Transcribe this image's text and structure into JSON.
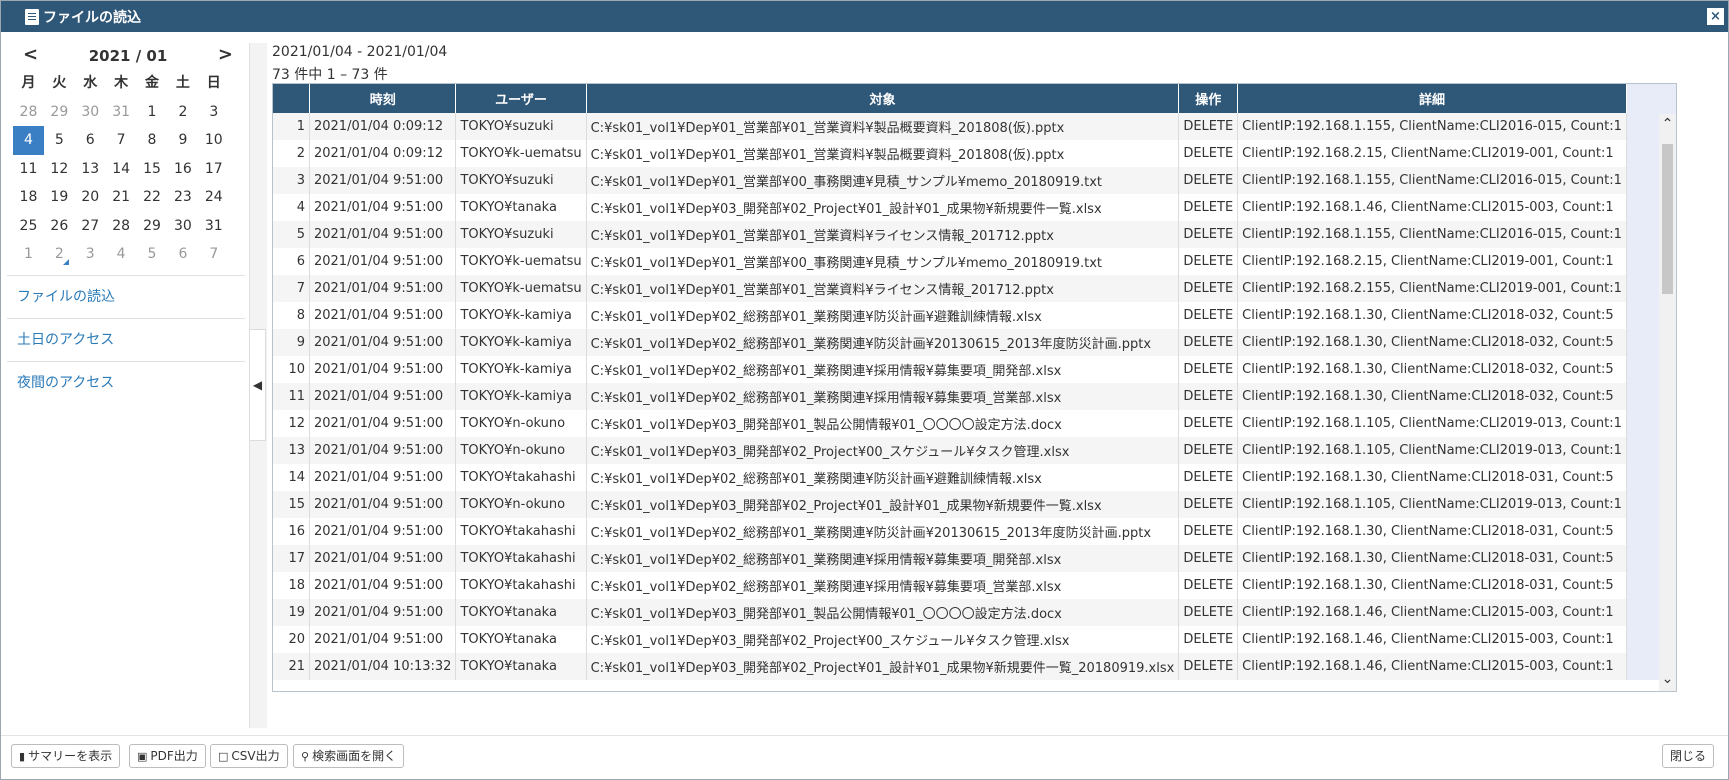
{
  "window": {
    "title": "ファイルの読込",
    "close_label": "×"
  },
  "calendar": {
    "month_label": "2021 / 01",
    "prev": "<",
    "next": ">",
    "weekdays": [
      "月",
      "火",
      "水",
      "木",
      "金",
      "土",
      "日"
    ],
    "days": [
      {
        "d": "28",
        "muted": true
      },
      {
        "d": "29",
        "muted": true
      },
      {
        "d": "30",
        "muted": true
      },
      {
        "d": "31",
        "muted": true
      },
      {
        "d": "1"
      },
      {
        "d": "2"
      },
      {
        "d": "3"
      },
      {
        "d": "4",
        "selected": true
      },
      {
        "d": "5"
      },
      {
        "d": "6"
      },
      {
        "d": "7"
      },
      {
        "d": "8"
      },
      {
        "d": "9"
      },
      {
        "d": "10"
      },
      {
        "d": "11"
      },
      {
        "d": "12"
      },
      {
        "d": "13"
      },
      {
        "d": "14"
      },
      {
        "d": "15"
      },
      {
        "d": "16"
      },
      {
        "d": "17"
      },
      {
        "d": "18"
      },
      {
        "d": "19"
      },
      {
        "d": "20"
      },
      {
        "d": "21"
      },
      {
        "d": "22"
      },
      {
        "d": "23"
      },
      {
        "d": "24"
      },
      {
        "d": "25"
      },
      {
        "d": "26"
      },
      {
        "d": "27"
      },
      {
        "d": "28"
      },
      {
        "d": "29"
      },
      {
        "d": "30"
      },
      {
        "d": "31"
      },
      {
        "d": "1",
        "muted": true
      },
      {
        "d": "2",
        "muted": true,
        "mark": true
      },
      {
        "d": "3",
        "muted": true
      },
      {
        "d": "4",
        "muted": true
      },
      {
        "d": "5",
        "muted": true
      },
      {
        "d": "6",
        "muted": true
      },
      {
        "d": "7",
        "muted": true
      }
    ]
  },
  "menu": [
    "ファイルの読込",
    "土日のアクセス",
    "夜間のアクセス"
  ],
  "collapse_label": "◀",
  "range_text": "2021/01/04 - 2021/01/04",
  "count_text": "73 件中 1 – 73 件",
  "table": {
    "headers": [
      "",
      "時刻",
      "ユーザー",
      "対象",
      "操作",
      "詳細"
    ],
    "rows": [
      [
        "1",
        "2021/01/04 0:09:12",
        "TOKYO¥suzuki",
        "C:¥sk01_vol1¥Dep¥01_営業部¥01_営業資料¥製品概要資料_201808(仮).pptx",
        "DELETE",
        "ClientIP:192.168.1.155, ClientName:CLI2016-015, Count:1"
      ],
      [
        "2",
        "2021/01/04 0:09:12",
        "TOKYO¥k-uematsu",
        "C:¥sk01_vol1¥Dep¥01_営業部¥01_営業資料¥製品概要資料_201808(仮).pptx",
        "DELETE",
        "ClientIP:192.168.2.15, ClientName:CLI2019-001, Count:1"
      ],
      [
        "3",
        "2021/01/04 9:51:00",
        "TOKYO¥suzuki",
        "C:¥sk01_vol1¥Dep¥01_営業部¥00_事務関連¥見積_サンプル¥memo_20180919.txt",
        "DELETE",
        "ClientIP:192.168.1.155, ClientName:CLI2016-015, Count:1"
      ],
      [
        "4",
        "2021/01/04 9:51:00",
        "TOKYO¥tanaka",
        "C:¥sk01_vol1¥Dep¥03_開発部¥02_Project¥01_設計¥01_成果物¥新規要件一覧.xlsx",
        "DELETE",
        "ClientIP:192.168.1.46, ClientName:CLI2015-003, Count:1"
      ],
      [
        "5",
        "2021/01/04 9:51:00",
        "TOKYO¥suzuki",
        "C:¥sk01_vol1¥Dep¥01_営業部¥01_営業資料¥ライセンス情報_201712.pptx",
        "DELETE",
        "ClientIP:192.168.1.155, ClientName:CLI2016-015, Count:1"
      ],
      [
        "6",
        "2021/01/04 9:51:00",
        "TOKYO¥k-uematsu",
        "C:¥sk01_vol1¥Dep¥01_営業部¥00_事務関連¥見積_サンプル¥memo_20180919.txt",
        "DELETE",
        "ClientIP:192.168.2.15, ClientName:CLI2019-001, Count:1"
      ],
      [
        "7",
        "2021/01/04 9:51:00",
        "TOKYO¥k-uematsu",
        "C:¥sk01_vol1¥Dep¥01_営業部¥01_営業資料¥ライセンス情報_201712.pptx",
        "DELETE",
        "ClientIP:192.168.2.155, ClientName:CLI2019-001, Count:1"
      ],
      [
        "8",
        "2021/01/04 9:51:00",
        "TOKYO¥k-kamiya",
        "C:¥sk01_vol1¥Dep¥02_総務部¥01_業務関連¥防災計画¥避難訓練情報.xlsx",
        "DELETE",
        "ClientIP:192.168.1.30, ClientName:CLI2018-032, Count:5"
      ],
      [
        "9",
        "2021/01/04 9:51:00",
        "TOKYO¥k-kamiya",
        "C:¥sk01_vol1¥Dep¥02_総務部¥01_業務関連¥防災計画¥20130615_2013年度防災計画.pptx",
        "DELETE",
        "ClientIP:192.168.1.30, ClientName:CLI2018-032, Count:5"
      ],
      [
        "10",
        "2021/01/04 9:51:00",
        "TOKYO¥k-kamiya",
        "C:¥sk01_vol1¥Dep¥02_総務部¥01_業務関連¥採用情報¥募集要項_開発部.xlsx",
        "DELETE",
        "ClientIP:192.168.1.30, ClientName:CLI2018-032, Count:5"
      ],
      [
        "11",
        "2021/01/04 9:51:00",
        "TOKYO¥k-kamiya",
        "C:¥sk01_vol1¥Dep¥02_総務部¥01_業務関連¥採用情報¥募集要項_営業部.xlsx",
        "DELETE",
        "ClientIP:192.168.1.30, ClientName:CLI2018-032, Count:5"
      ],
      [
        "12",
        "2021/01/04 9:51:00",
        "TOKYO¥n-okuno",
        "C:¥sk01_vol1¥Dep¥03_開発部¥01_製品公開情報¥01_〇〇〇〇設定方法.docx",
        "DELETE",
        "ClientIP:192.168.1.105, ClientName:CLI2019-013, Count:1"
      ],
      [
        "13",
        "2021/01/04 9:51:00",
        "TOKYO¥n-okuno",
        "C:¥sk01_vol1¥Dep¥03_開発部¥02_Project¥00_スケジュール¥タスク管理.xlsx",
        "DELETE",
        "ClientIP:192.168.1.105, ClientName:CLI2019-013, Count:1"
      ],
      [
        "14",
        "2021/01/04 9:51:00",
        "TOKYO¥takahashi",
        "C:¥sk01_vol1¥Dep¥02_総務部¥01_業務関連¥防災計画¥避難訓練情報.xlsx",
        "DELETE",
        "ClientIP:192.168.1.30, ClientName:CLI2018-031, Count:5"
      ],
      [
        "15",
        "2021/01/04 9:51:00",
        "TOKYO¥n-okuno",
        "C:¥sk01_vol1¥Dep¥03_開発部¥02_Project¥01_設計¥01_成果物¥新規要件一覧.xlsx",
        "DELETE",
        "ClientIP:192.168.1.105, ClientName:CLI2019-013, Count:1"
      ],
      [
        "16",
        "2021/01/04 9:51:00",
        "TOKYO¥takahashi",
        "C:¥sk01_vol1¥Dep¥02_総務部¥01_業務関連¥防災計画¥20130615_2013年度防災計画.pptx",
        "DELETE",
        "ClientIP:192.168.1.30, ClientName:CLI2018-031, Count:5"
      ],
      [
        "17",
        "2021/01/04 9:51:00",
        "TOKYO¥takahashi",
        "C:¥sk01_vol1¥Dep¥02_総務部¥01_業務関連¥採用情報¥募集要項_開発部.xlsx",
        "DELETE",
        "ClientIP:192.168.1.30, ClientName:CLI2018-031, Count:5"
      ],
      [
        "18",
        "2021/01/04 9:51:00",
        "TOKYO¥takahashi",
        "C:¥sk01_vol1¥Dep¥02_総務部¥01_業務関連¥採用情報¥募集要項_営業部.xlsx",
        "DELETE",
        "ClientIP:192.168.1.30, ClientName:CLI2018-031, Count:5"
      ],
      [
        "19",
        "2021/01/04 9:51:00",
        "TOKYO¥tanaka",
        "C:¥sk01_vol1¥Dep¥03_開発部¥01_製品公開情報¥01_〇〇〇〇設定方法.docx",
        "DELETE",
        "ClientIP:192.168.1.46, ClientName:CLI2015-003, Count:1"
      ],
      [
        "20",
        "2021/01/04 9:51:00",
        "TOKYO¥tanaka",
        "C:¥sk01_vol1¥Dep¥03_開発部¥02_Project¥00_スケジュール¥タスク管理.xlsx",
        "DELETE",
        "ClientIP:192.168.1.46, ClientName:CLI2015-003, Count:1"
      ],
      [
        "21",
        "2021/01/04 10:13:32",
        "TOKYO¥tanaka",
        "C:¥sk01_vol1¥Dep¥03_開発部¥02_Project¥01_設計¥01_成果物¥新規要件一覧_20180919.xlsx",
        "DELETE",
        "ClientIP:192.168.1.46, ClientName:CLI2015-003, Count:1"
      ]
    ]
  },
  "footer": {
    "summary": "サマリーを表示",
    "pdf": "PDF出力",
    "csv": "CSV出力",
    "search": "検索画面を開く",
    "close": "閉じる"
  },
  "colors": {
    "header": "#2f5778",
    "accent": "#3a7fc4",
    "link": "#2a7ab8"
  }
}
